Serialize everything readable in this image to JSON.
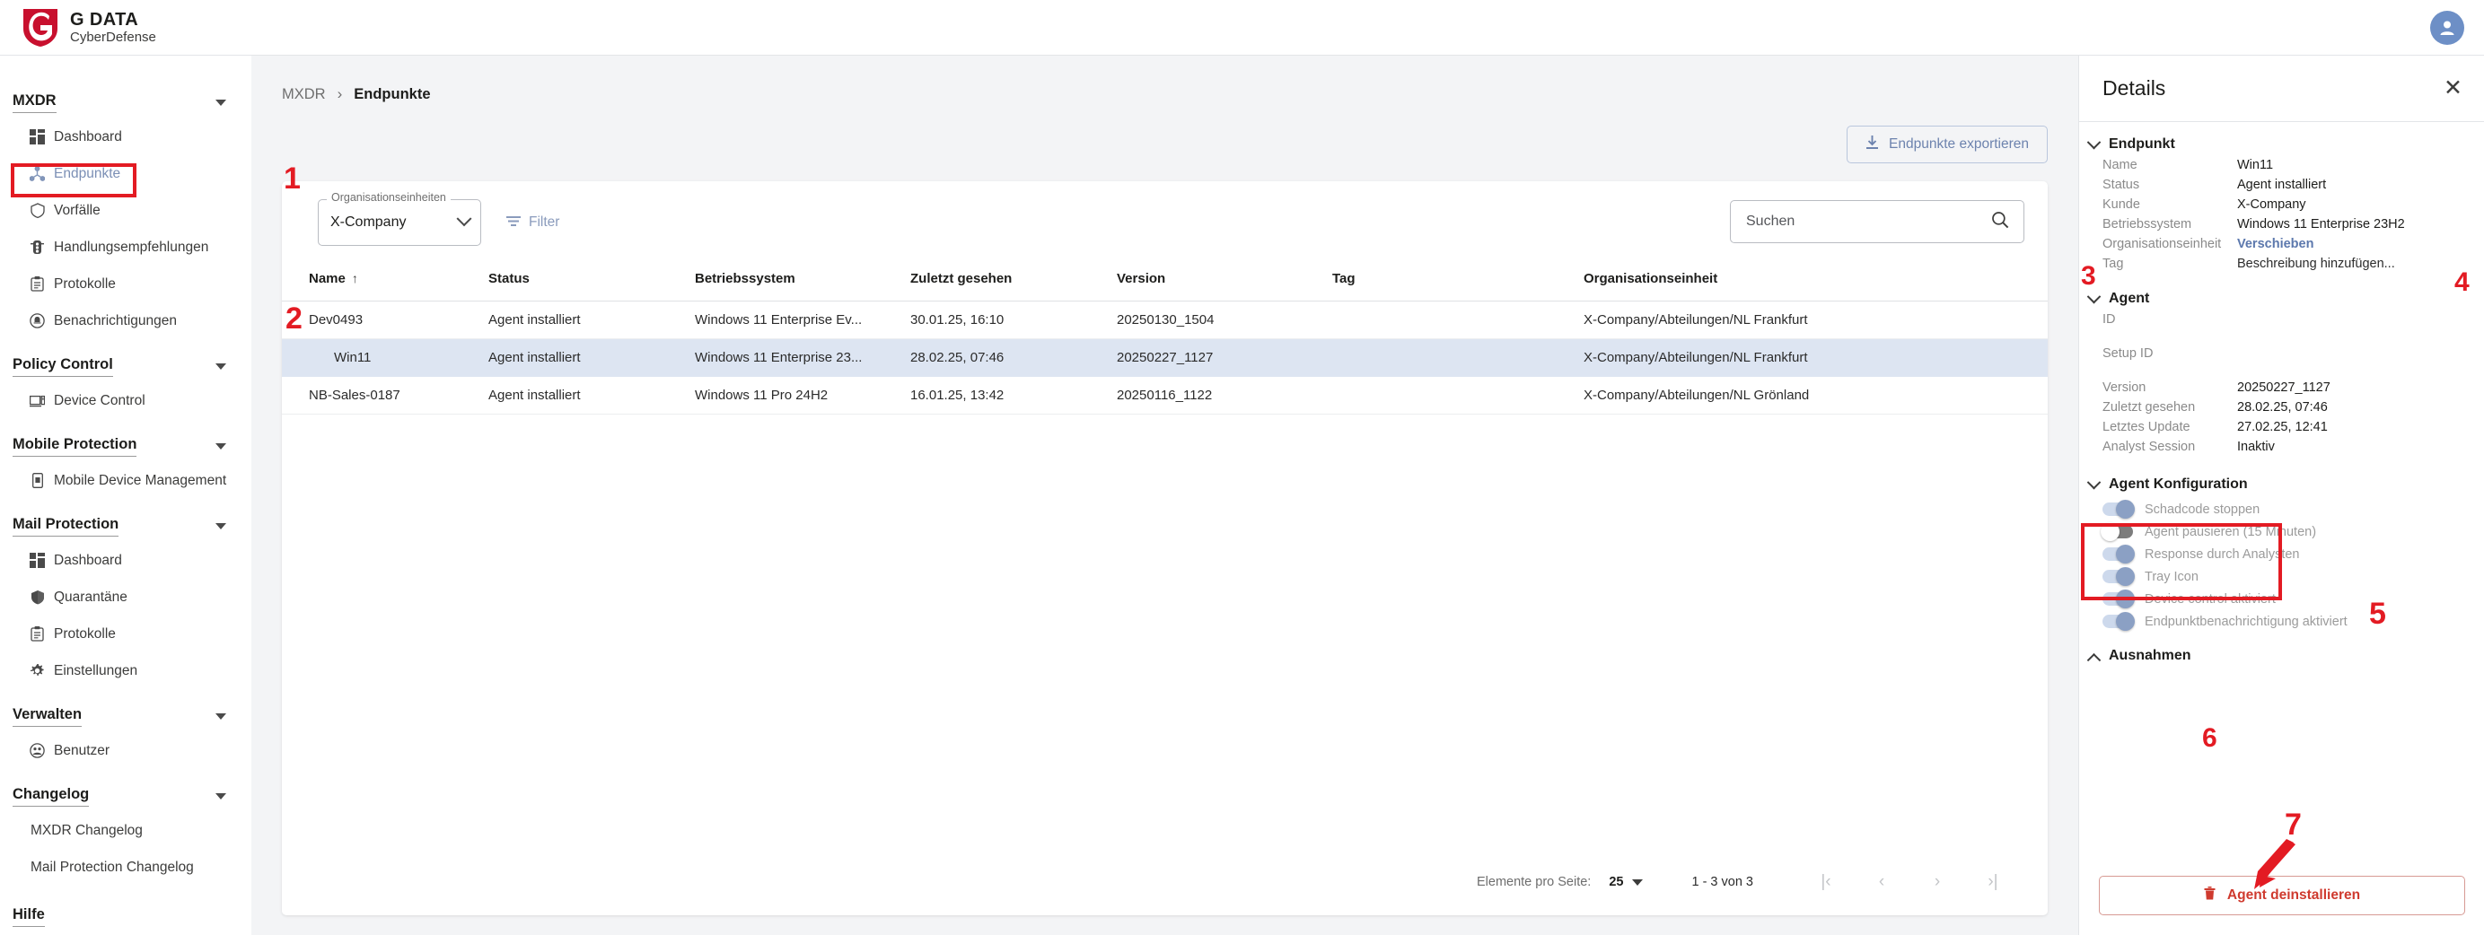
{
  "brand": {
    "title": "G DATA",
    "subtitle": "CyberDefense",
    "logo_color": "#c8102e"
  },
  "header": {
    "avatar_icon": "user-avatar-icon"
  },
  "sidebar": {
    "groups": [
      {
        "label": "MXDR",
        "items": [
          {
            "label": "Dashboard",
            "icon": "dashboard-icon",
            "active": false
          },
          {
            "label": "Endpunkte",
            "icon": "endpoints-icon",
            "active": true
          },
          {
            "label": "Vorfälle",
            "icon": "shield-icon",
            "active": false
          },
          {
            "label": "Handlungsempfehlungen",
            "icon": "traffic-light-icon",
            "active": false
          },
          {
            "label": "Protokolle",
            "icon": "clipboard-icon",
            "active": false
          },
          {
            "label": "Benachrichtigungen",
            "icon": "bell-circle-icon",
            "active": false
          }
        ]
      },
      {
        "label": "Policy Control",
        "items": [
          {
            "label": "Device Control",
            "icon": "device-icon",
            "active": false
          }
        ]
      },
      {
        "label": "Mobile Protection",
        "items": [
          {
            "label": "Mobile Device Management",
            "icon": "mobile-icon",
            "active": false
          }
        ]
      },
      {
        "label": "Mail Protection",
        "items": [
          {
            "label": "Dashboard",
            "icon": "dashboard-icon",
            "active": false
          },
          {
            "label": "Quarantäne",
            "icon": "shield-filled-icon",
            "active": false
          },
          {
            "label": "Protokolle",
            "icon": "clipboard-icon",
            "active": false
          },
          {
            "label": "Einstellungen",
            "icon": "gear-icon",
            "active": false
          }
        ]
      },
      {
        "label": "Verwalten",
        "items": [
          {
            "label": "Benutzer",
            "icon": "users-icon",
            "active": false
          }
        ]
      },
      {
        "label": "Changelog",
        "items": [
          {
            "label": "MXDR Changelog",
            "icon": "",
            "active": false
          },
          {
            "label": "Mail Protection Changelog",
            "icon": "",
            "active": false
          }
        ]
      },
      {
        "label": "Hilfe",
        "items": []
      }
    ]
  },
  "main": {
    "breadcrumb": {
      "root": "MXDR",
      "separator": "›",
      "current": "Endpunkte"
    },
    "export_button": {
      "label": "Endpunkte exportieren",
      "icon": "download-icon"
    },
    "org_select": {
      "label": "Organisationseinheiten",
      "value": "X-Company",
      "icon": "chevron-down-icon"
    },
    "filter_button": {
      "label": "Filter",
      "icon": "filter-icon"
    },
    "search": {
      "placeholder": "Suchen",
      "icon": "search-icon"
    },
    "table": {
      "columns": [
        "Name",
        "Status",
        "Betriebssystem",
        "Zuletzt gesehen",
        "Version",
        "Tag",
        "Organisationseinheit"
      ],
      "sort_column": "Name",
      "sort_direction": "↑",
      "rows": [
        {
          "name": "Dev0493",
          "status": "Agent installiert",
          "os": "Windows 11 Enterprise Ev...",
          "last_seen": "30.01.25, 16:10",
          "version": "20250130_1504",
          "tag": "",
          "org": "X-Company/Abteilungen/NL Frankfurt",
          "selected": false
        },
        {
          "name": "Win11",
          "status": "Agent installiert",
          "os": "Windows 11 Enterprise 23...",
          "last_seen": "28.02.25, 07:46",
          "version": "20250227_1127",
          "tag": "",
          "org": "X-Company/Abteilungen/NL Frankfurt",
          "selected": true
        },
        {
          "name": "NB-Sales-0187",
          "status": "Agent installiert",
          "os": "Windows 11 Pro 24H2",
          "last_seen": "16.01.25, 13:42",
          "version": "20250116_1122",
          "tag": "",
          "org": "X-Company/Abteilungen/NL Grönland",
          "selected": false
        }
      ]
    },
    "pagination": {
      "per_page_label": "Elemente pro Seite:",
      "per_page_value": "25",
      "range": "1 - 3 von 3",
      "first": "|‹",
      "prev": "‹",
      "next": "›",
      "last": "›|"
    }
  },
  "details": {
    "title": "Details",
    "close_icon": "close-icon",
    "endpoint_section": {
      "title": "Endpunkt",
      "expanded": true,
      "fields": [
        {
          "key": "Name",
          "value": "Win11",
          "type": "text"
        },
        {
          "key": "Status",
          "value": "Agent installiert",
          "type": "text"
        },
        {
          "key": "Kunde",
          "value": "X-Company",
          "type": "text"
        },
        {
          "key": "Betriebssystem",
          "value": "Windows 11 Enterprise 23H2",
          "type": "text"
        },
        {
          "key": "Organisationseinheit",
          "value": "Verschieben",
          "type": "link"
        },
        {
          "key": "Tag",
          "value": "Beschreibung hinzufügen...",
          "type": "text"
        }
      ]
    },
    "agent_section": {
      "title": "Agent",
      "expanded": true,
      "fields": [
        {
          "key": "ID",
          "value": "",
          "type": "text"
        },
        {
          "key": "Setup ID",
          "value": "",
          "type": "text"
        },
        {
          "key": "Version",
          "value": "20250227_1127",
          "type": "text"
        },
        {
          "key": "Zuletzt gesehen",
          "value": "28.02.25, 07:46",
          "type": "text"
        },
        {
          "key": "Letztes Update",
          "value": "27.02.25, 12:41",
          "type": "text"
        },
        {
          "key": "Analyst Session",
          "value": "Inaktiv",
          "type": "text"
        }
      ]
    },
    "config_section": {
      "title": "Agent Konfiguration",
      "expanded": true,
      "toggles": [
        {
          "label": "Schadcode stoppen",
          "on": true
        },
        {
          "label": "Agent pausieren (15 Minuten)",
          "on": false
        },
        {
          "label": "Response durch Analysten",
          "on": true
        },
        {
          "label": "Tray Icon",
          "on": true
        },
        {
          "label": "Device control aktiviert",
          "on": true
        },
        {
          "label": "Endpunktbenachrichtigung aktiviert",
          "on": true
        }
      ]
    },
    "exceptions_section": {
      "title": "Ausnahmen",
      "expanded": false
    },
    "uninstall_button": {
      "label": "Agent deinstallieren",
      "icon": "trash-icon"
    }
  },
  "annotations": {
    "color": "#e31b23",
    "markers": [
      {
        "id": "1",
        "target": "org-select"
      },
      {
        "id": "2",
        "target": "selected-table-row"
      },
      {
        "id": "3",
        "target": "organisationseinheit-field"
      },
      {
        "id": "4",
        "target": "tag-field"
      },
      {
        "id": "5",
        "target": "agent-konfiguration-section"
      },
      {
        "id": "6",
        "target": "ausnahmen-section"
      },
      {
        "id": "7",
        "target": "uninstall-button"
      }
    ]
  }
}
